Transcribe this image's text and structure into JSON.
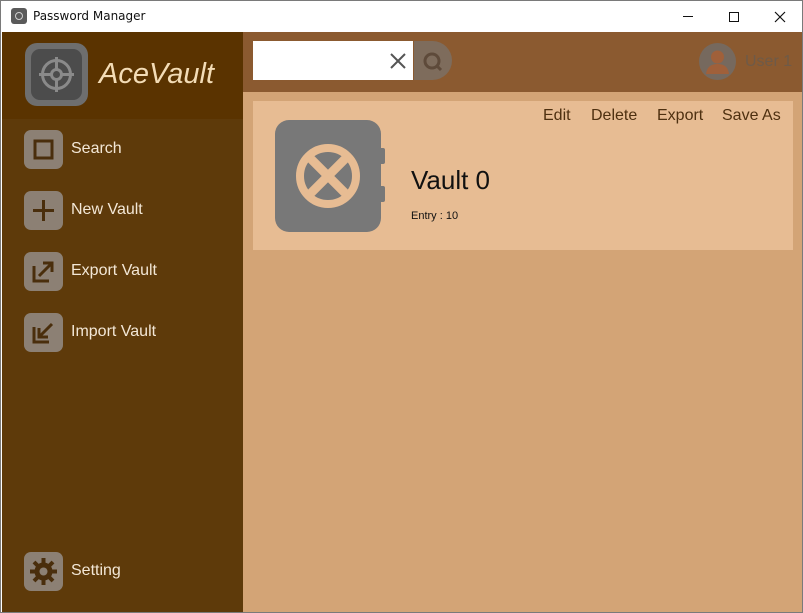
{
  "window": {
    "title": "Password Manager"
  },
  "sidebar": {
    "app_name": "AceVault",
    "items": [
      {
        "label": "Search",
        "icon": "search-icon"
      },
      {
        "label": "New Vault",
        "icon": "plus-icon"
      },
      {
        "label": "Export Vault",
        "icon": "export-icon"
      },
      {
        "label": "Import Vault",
        "icon": "import-icon"
      }
    ],
    "settings": {
      "label": "Setting",
      "icon": "gear-icon"
    }
  },
  "topbar": {
    "search_value": "",
    "search_placeholder": "",
    "user_name": "User 1"
  },
  "vaults": [
    {
      "name": "Vault 0",
      "entry_label": "Entry : 10",
      "actions": [
        "Edit",
        "Delete",
        "Export",
        "Save As"
      ]
    }
  ],
  "colors": {
    "sidebar": "#5e3a0a",
    "logo_area": "#5a3300",
    "topbar": "#8b5a30",
    "content": "#d3a476",
    "card": "#e7bc93",
    "icon_gray": "#7a7a7a",
    "accent_text": "#f3dcb6"
  }
}
